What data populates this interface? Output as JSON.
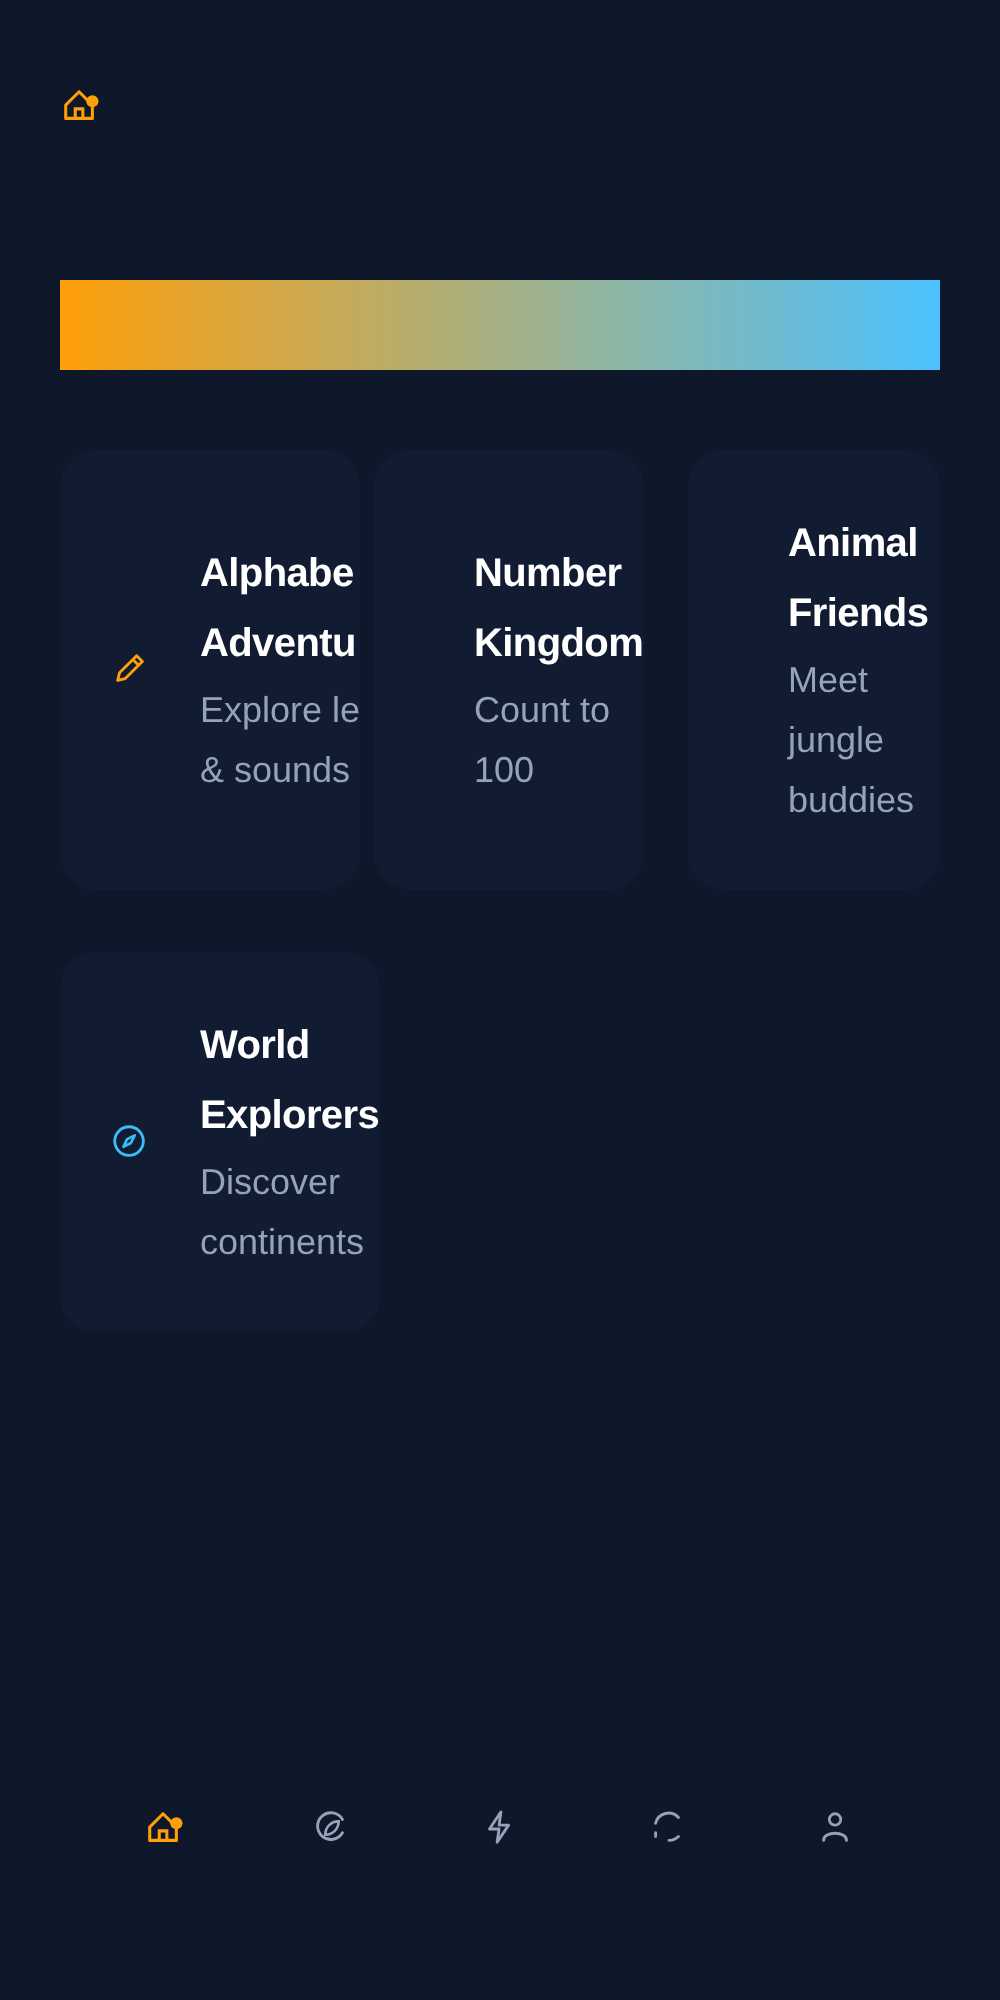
{
  "header": {
    "kind": "logo"
  },
  "banner": {
    "kind": "gradient"
  },
  "cards": [
    {
      "title": [
        "Alphabe",
        "Adventu"
      ],
      "subtitle": [
        "Explore le",
        "& sounds"
      ]
    },
    {
      "title": [
        "Number",
        "Kingdom"
      ],
      "subtitle": [
        "Count to",
        "100"
      ]
    },
    {
      "title": [
        "Animal",
        "Friends"
      ],
      "subtitle": [
        "Meet",
        "jungle",
        "buddies"
      ]
    },
    {
      "title": [
        "World",
        "Explorers"
      ],
      "subtitle": [
        "Discover",
        "continents"
      ]
    }
  ],
  "nav": [
    {
      "selected": true
    },
    {
      "selected": false
    },
    {
      "selected": false
    },
    {
      "selected": false
    },
    {
      "selected": false
    }
  ]
}
